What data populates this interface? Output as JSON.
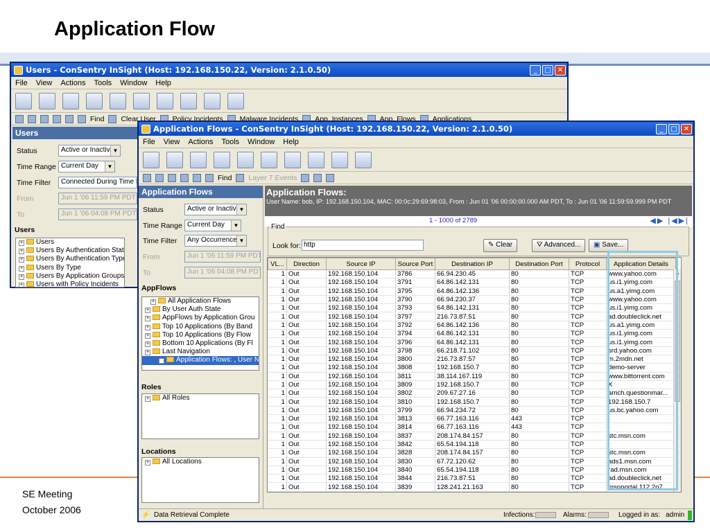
{
  "slide": {
    "title": "Application Flow",
    "footer_line1": "SE Meeting",
    "footer_line2": "October 2006"
  },
  "back_window": {
    "title": "Users - ConSentry InSight (Host: 192.168.150.22, Version: 2.1.0.50)",
    "menu": [
      "File",
      "View",
      "Actions",
      "Tools",
      "Window",
      "Help"
    ],
    "toolbar2": [
      "Find",
      "Clear User",
      "Policy Incidents",
      "Malware Incidents",
      "App. Instances",
      "App. Flows",
      "Applications"
    ],
    "panel_title": "Users",
    "status_label": "Status",
    "status_value": "Active or Inactive",
    "time_range_label": "Time Range",
    "time_range_value": "Current Day",
    "time_filter_label": "Time Filter",
    "time_filter_value": "Connected During Time R",
    "from_label": "From",
    "from_value": "Jun 1 '06 11:59 PM PDT",
    "to_label": "To",
    "to_value": "Jun 1 '06 04:08 PM PDT",
    "tree_title": "Users",
    "tree": [
      "Users",
      "Users By Authentication State",
      "Users By Authentication Type",
      "Users By Type",
      "Users By Application Groups",
      "Users with Policy Incidents"
    ]
  },
  "front_window": {
    "title": "Application Flows - ConSentry InSight (Host: 192.168.150.22, Version: 2.1.0.50)",
    "menu": [
      "File",
      "View",
      "Actions",
      "Tools",
      "Window",
      "Help"
    ],
    "toolbar2_find": "Find",
    "toolbar2_layer7": "Layer 7 Events",
    "left": {
      "panel_title": "Application Flows",
      "status_label": "Status",
      "status_value": "Active or Inactive",
      "time_range_label": "Time Range",
      "time_range_value": "Current Day",
      "time_filter_label": "Time Filter",
      "time_filter_value": "Any Occurrence",
      "from_label": "From",
      "from_value": "Jun 1 '06 11:59 PM PDT",
      "to_label": "To",
      "to_value": "Jun 1 '06 04:08 PM PDT",
      "appflows_title": "AppFlows",
      "appflows_tree": [
        "All Application Flows",
        "By User Auth State",
        "AppFlows by Application Grou",
        "Top 10 Applications (By Band",
        "Top 10 Applications (By Flow",
        "Bottom 10 Applications (By Fl",
        "Last Navigation",
        "Application Flows: , User N"
      ],
      "roles_title": "Roles",
      "roles_tree": [
        "All Roles"
      ],
      "locations_title": "Locations",
      "locations_tree": [
        "All Locations"
      ]
    },
    "main": {
      "header_title": "Application Flows:",
      "header_info": "User Name: bob, IP: 192.168.150.104, MAC: 00:0c:29:69:98:03, From : Jun 01 '06 00:00:00.000 AM PDT, To : Jun 01 '06 11:59:59.999 PM PDT",
      "range": "1 - 1000 of 2789",
      "find_label": "Find",
      "lookfor_label": "Look for:",
      "lookfor_value": "http",
      "clear_btn": "Clear",
      "advanced_btn": "Advanced...",
      "save_btn": "Save...",
      "columns": [
        "VL...",
        "Direction",
        "Source IP",
        "Source Port",
        "Destination IP",
        "Destination Port",
        "Protocol",
        "Application Details"
      ],
      "rows": [
        [
          "1",
          "Out",
          "192.168.150.104",
          "3786",
          "66.94.230.45",
          "80",
          "TCP",
          "www.yahoo.com"
        ],
        [
          "1",
          "Out",
          "192.168.150.104",
          "3791",
          "64.86.142.131",
          "80",
          "TCP",
          "us.i1.yimg.com"
        ],
        [
          "1",
          "Out",
          "192.168.150.104",
          "3795",
          "64.86.142.136",
          "80",
          "TCP",
          "us.a1.yimg.com"
        ],
        [
          "1",
          "Out",
          "192.168.150.104",
          "3790",
          "66.94.230.37",
          "80",
          "TCP",
          "www.yahoo.com"
        ],
        [
          "1",
          "Out",
          "192.168.150.104",
          "3793",
          "64.86.142.131",
          "80",
          "TCP",
          "us.i1.yimg.com"
        ],
        [
          "1",
          "Out",
          "192.168.150.104",
          "3797",
          "216.73.87.51",
          "80",
          "TCP",
          "ad.doubleclick.net"
        ],
        [
          "1",
          "Out",
          "192.168.150.104",
          "3792",
          "64.86.142.136",
          "80",
          "TCP",
          "us.a1.yimg.com"
        ],
        [
          "1",
          "Out",
          "192.168.150.104",
          "3794",
          "64.86.142.131",
          "80",
          "TCP",
          "us.i1.yimg.com"
        ],
        [
          "1",
          "Out",
          "192.168.150.104",
          "3796",
          "64.86.142.131",
          "80",
          "TCP",
          "us.i1.yimg.com"
        ],
        [
          "1",
          "Out",
          "192.168.150.104",
          "3798",
          "66.218.71.102",
          "80",
          "TCP",
          "srd.yahoo.com"
        ],
        [
          "1",
          "Out",
          "192.168.150.104",
          "3800",
          "216.73.87.57",
          "80",
          "TCP",
          "m.2mdn.net"
        ],
        [
          "1",
          "Out",
          "192.168.150.104",
          "3808",
          "192.168.150.7",
          "80",
          "TCP",
          "demo-server"
        ],
        [
          "1",
          "Out",
          "192.168.150.104",
          "3811",
          "38.114.167.119",
          "80",
          "TCP",
          "www.bittorrent.com"
        ],
        [
          "1",
          "Out",
          "192.168.150.104",
          "3809",
          "192.168.150.7",
          "80",
          "TCP",
          "X"
        ],
        [
          "1",
          "Out",
          "192.168.150.104",
          "3802",
          "209.67.27.16",
          "80",
          "TCP",
          "amch.questionmar..."
        ],
        [
          "1",
          "Out",
          "192.168.150.104",
          "3810",
          "192.168.150.7",
          "80",
          "TCP",
          "192.168.150.7"
        ],
        [
          "1",
          "Out",
          "192.168.150.104",
          "3799",
          "66.94.234.72",
          "80",
          "TCP",
          "us.bc.yahoo.com"
        ],
        [
          "1",
          "Out",
          "192.168.150.104",
          "3813",
          "66.77.163.116",
          "443",
          "TCP",
          ""
        ],
        [
          "1",
          "Out",
          "192.168.150.104",
          "3814",
          "66.77.163.116",
          "443",
          "TCP",
          ""
        ],
        [
          "1",
          "Out",
          "192.168.150.104",
          "3837",
          "208.174.84.157",
          "80",
          "TCP",
          "stc.msn.com"
        ],
        [
          "1",
          "Out",
          "192.168.150.104",
          "3842",
          "65.54.194.118",
          "80",
          "TCP",
          ""
        ],
        [
          "1",
          "Out",
          "192.168.150.104",
          "3828",
          "208.174.84.157",
          "80",
          "TCP",
          "stc.msn.com"
        ],
        [
          "1",
          "Out",
          "192.168.150.104",
          "3830",
          "67.72.120.62",
          "80",
          "TCP",
          "ads1.msn.com"
        ],
        [
          "1",
          "Out",
          "192.168.150.104",
          "3840",
          "65.54.194.118",
          "80",
          "TCP",
          "rad.msn.com"
        ],
        [
          "1",
          "Out",
          "192.168.150.104",
          "3844",
          "216.73.87.51",
          "80",
          "TCP",
          "ad.doubleclick.net"
        ],
        [
          "1",
          "Out",
          "192.168.150.104",
          "3839",
          "128.241.21.163",
          "80",
          "TCP",
          "msnportal.112.2o7...."
        ]
      ]
    },
    "statusbar": {
      "text": "Data Retrieval Complete",
      "infections_label": "Infections:",
      "alarms_label": "Alarms:",
      "logged_label": "Logged in as:",
      "user": "admin"
    }
  },
  "colors": {
    "highlight": "#8ecae6",
    "titlebar": "#0c4ac0",
    "panel_head": "#4a6fa5"
  }
}
